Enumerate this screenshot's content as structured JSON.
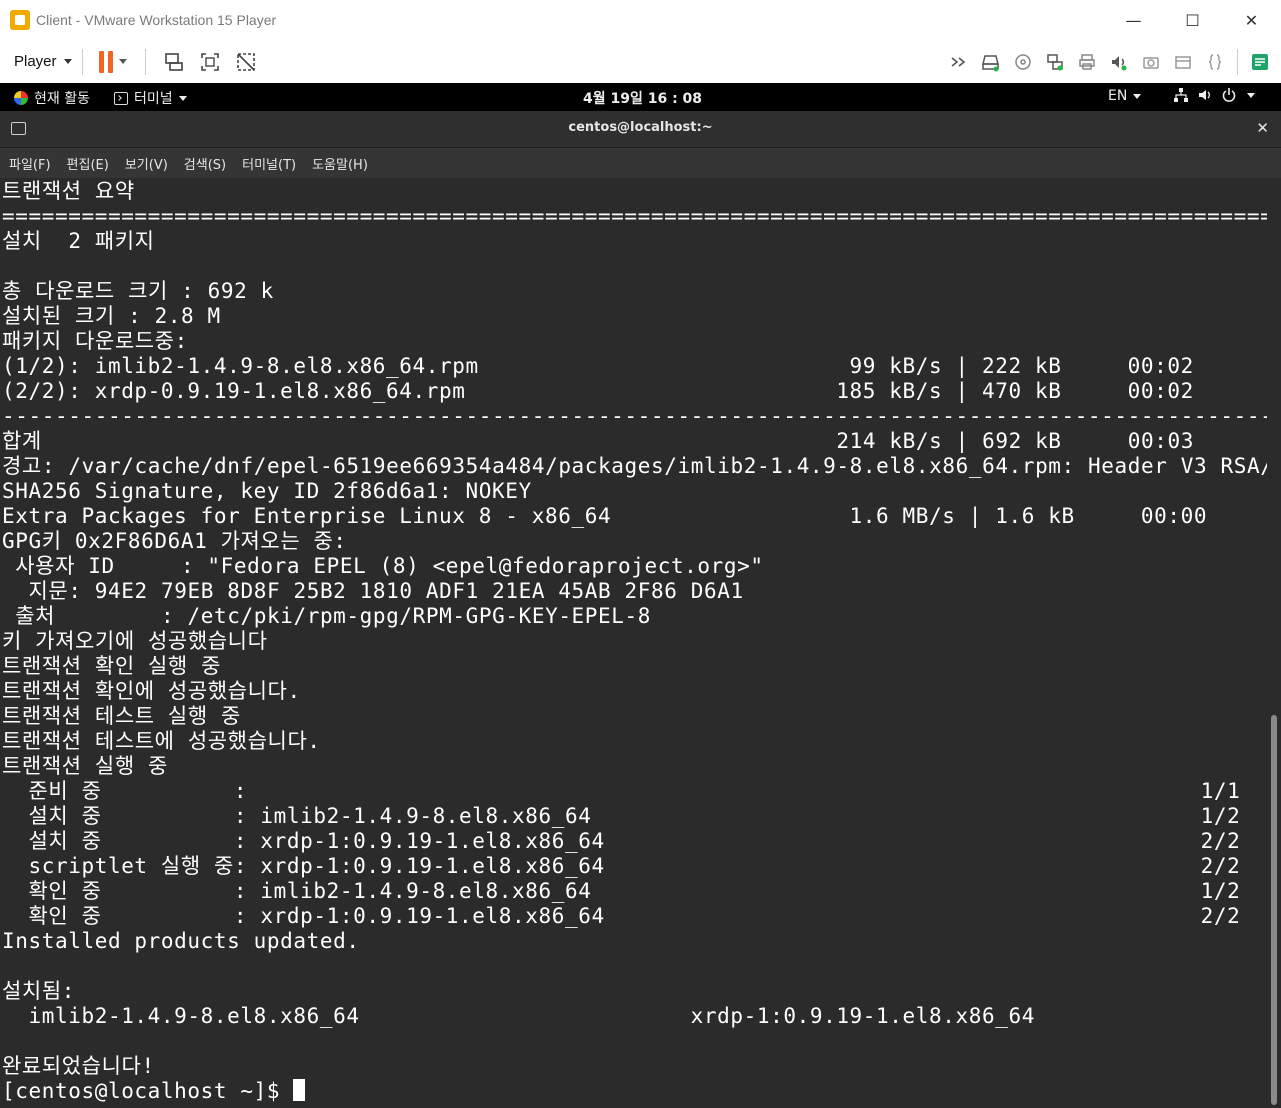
{
  "window": {
    "title": "Client - VMware Workstation 15 Player",
    "minimize": "—",
    "maximize": "☐",
    "close": "✕"
  },
  "toolbar": {
    "player_label": "Player"
  },
  "gnome": {
    "activities": "현재 활동",
    "terminal_menu": "터미널",
    "clock": "4월 19일  16 : 08",
    "lang": "EN"
  },
  "terminal": {
    "title": "centos@localhost:~",
    "close": "✕",
    "menu": [
      "파일(F)",
      "편집(E)",
      "보기(V)",
      "검색(S)",
      "터미널(T)",
      "도움말(H)"
    ],
    "lines": [
      "트랜잭션 요약",
      "================================================================================================",
      "설치  2 패키지",
      "",
      "총 다운로드 크기 : 692 k",
      "설치된 크기 : 2.8 M",
      "패키지 다운로드중:",
      "(1/2): imlib2-1.4.9-8.el8.x86_64.rpm                            99 kB/s | 222 kB     00:02",
      "(2/2): xrdp-0.9.19-1.el8.x86_64.rpm                            185 kB/s | 470 kB     00:02",
      "------------------------------------------------------------------------------------------------",
      "합계                                                            214 kB/s | 692 kB     00:03",
      "경고: /var/cache/dnf/epel-6519ee669354a484/packages/imlib2-1.4.9-8.el8.x86_64.rpm: Header V3 RSA/",
      "SHA256 Signature, key ID 2f86d6a1: NOKEY",
      "Extra Packages for Enterprise Linux 8 - x86_64                  1.6 MB/s | 1.6 kB     00:00",
      "GPG키 0x2F86D6A1 가져오는 중:",
      " 사용자 ID     : \"Fedora EPEL (8) <epel@fedoraproject.org>\"",
      "  지문: 94E2 79EB 8D8F 25B2 1810 ADF1 21EA 45AB 2F86 D6A1",
      " 출처        : /etc/pki/rpm-gpg/RPM-GPG-KEY-EPEL-8",
      "키 가져오기에 성공했습니다",
      "트랜잭션 확인 실행 중",
      "트랜잭션 확인에 성공했습니다.",
      "트랜잭션 테스트 실행 중",
      "트랜잭션 테스트에 성공했습니다.",
      "트랜잭션 실행 중",
      "  준비 중          :                                                                        1/1",
      "  설치 중          : imlib2-1.4.9-8.el8.x86_64                                              1/2",
      "  설치 중          : xrdp-1:0.9.19-1.el8.x86_64                                             2/2",
      "  scriptlet 실행 중: xrdp-1:0.9.19-1.el8.x86_64                                             2/2",
      "  확인 중          : imlib2-1.4.9-8.el8.x86_64                                              1/2",
      "  확인 중          : xrdp-1:0.9.19-1.el8.x86_64                                             2/2",
      "Installed products updated.",
      "",
      "설치됨:",
      "  imlib2-1.4.9-8.el8.x86_64                         xrdp-1:0.9.19-1.el8.x86_64",
      "",
      "완료되었습니다!"
    ],
    "prompt": "[centos@localhost ~]$ "
  }
}
